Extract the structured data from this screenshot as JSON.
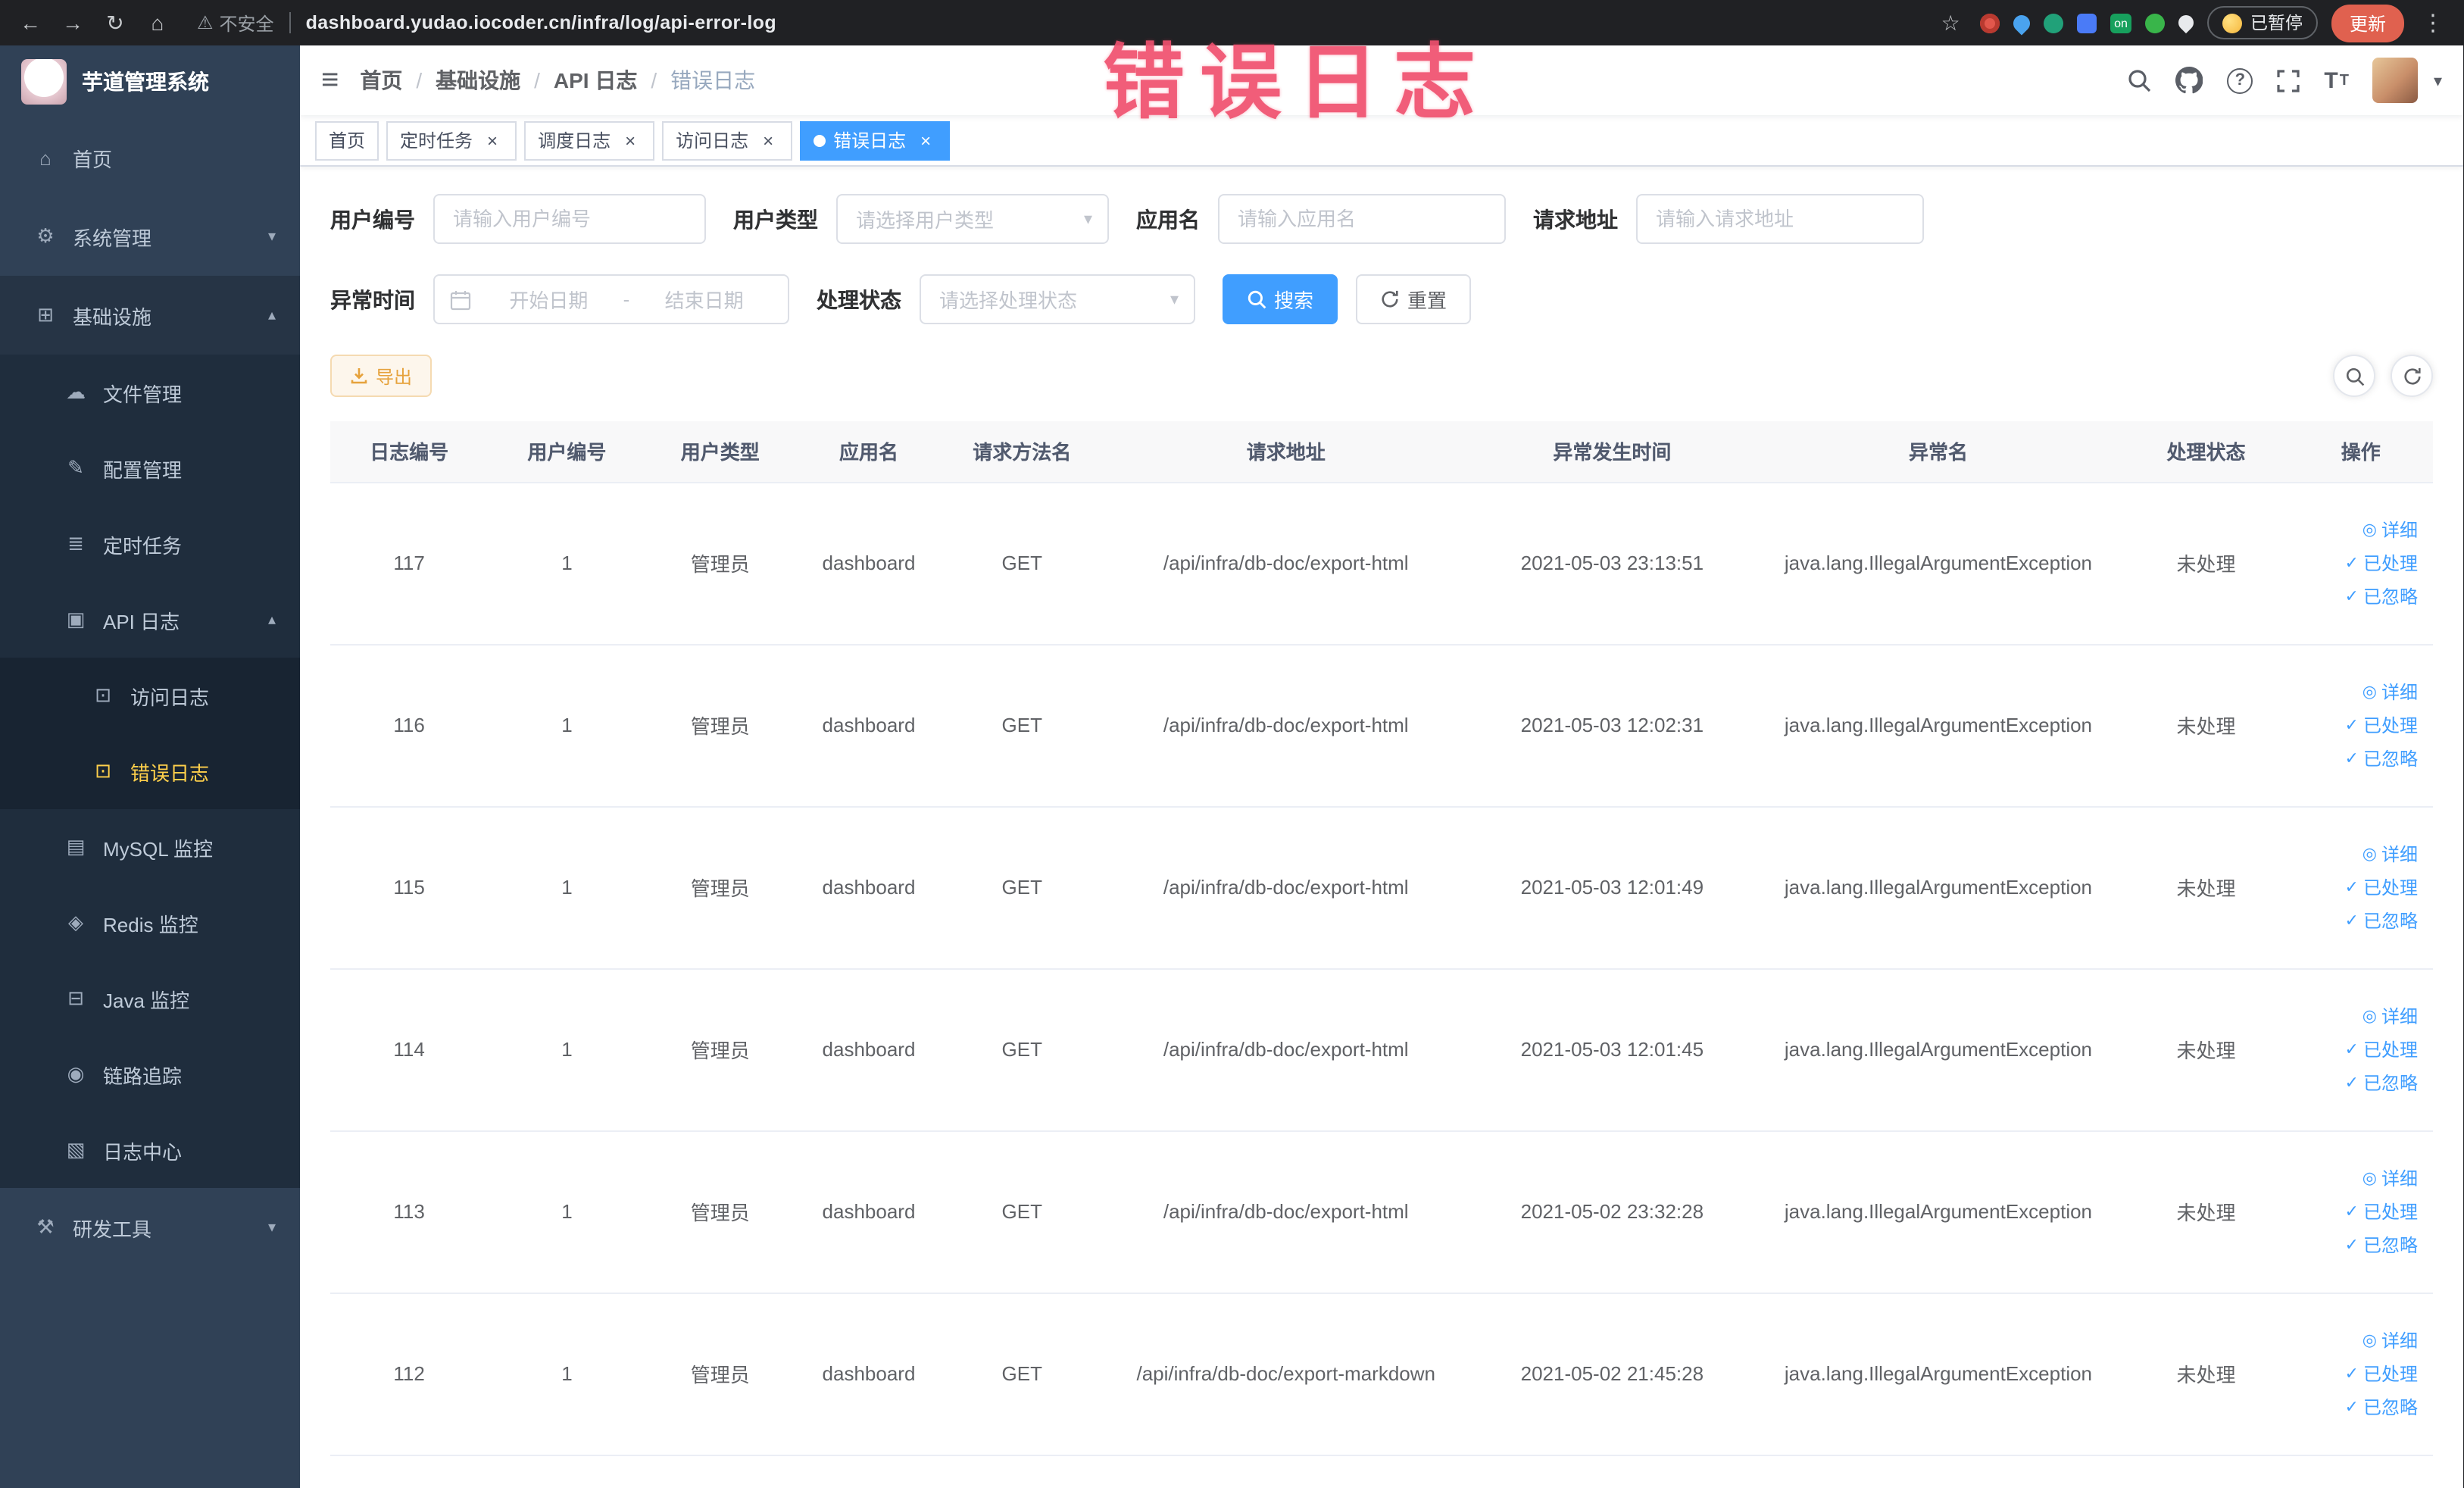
{
  "browser": {
    "security_label": "不安全",
    "url": "dashboard.yudao.iocoder.cn/infra/log/api-error-log",
    "extension_on_badge": "on",
    "paused_badge": "已暂停",
    "update_button": "更新"
  },
  "overlay": {
    "text": "错误日志",
    "color": "#f0506e"
  },
  "icons": {
    "back-icon": "←",
    "forward-icon": "→",
    "reload-icon": "↻",
    "browser-home-icon": "⌂",
    "warning-icon": "⚠",
    "star-icon": "☆",
    "kebab-icon": "⋮",
    "hamburger-icon": "≡",
    "help-icon": "?",
    "fontsize-icon": "T",
    "chevron-down-icon": "▾",
    "chevron-up-icon": "▴",
    "close-icon": "×",
    "home-icon": "⌂",
    "gear-icon": "⚙",
    "infrastructure-icon": "⊞",
    "file-manage-icon": "☁",
    "config-manage-icon": "✎",
    "cron-job-icon": "≣",
    "api-log-icon": "▣",
    "access-log-icon": "⊡",
    "error-log-icon": "⊡",
    "mysql-icon": "▤",
    "redis-icon": "◈",
    "java-icon": "⊟",
    "trace-icon": "◉",
    "log-center-icon": "▧",
    "dev-tools-icon": "⚒",
    "eye-icon": "◎",
    "check-icon": "✓"
  },
  "sidebar": {
    "logo_title": "芋道管理系统",
    "items": [
      {
        "key": "home",
        "label": "首页",
        "icon": "home-icon",
        "level": 1
      },
      {
        "key": "system-management",
        "label": "系统管理",
        "icon": "gear-icon",
        "level": 1,
        "arrow": "down"
      },
      {
        "key": "infrastructure",
        "label": "基础设施",
        "icon": "infrastructure-icon",
        "level": 1,
        "arrow": "up",
        "highlight": true
      },
      {
        "key": "file-management",
        "label": "文件管理",
        "icon": "file-manage-icon",
        "level": 2
      },
      {
        "key": "config-management",
        "label": "配置管理",
        "icon": "config-manage-icon",
        "level": 2
      },
      {
        "key": "cron-jobs",
        "label": "定时任务",
        "icon": "cron-job-icon",
        "level": 2
      },
      {
        "key": "api-logs",
        "label": "API 日志",
        "icon": "api-log-icon",
        "level": 2,
        "arrow": "up"
      },
      {
        "key": "access-log",
        "label": "访问日志",
        "icon": "access-log-icon",
        "level": 3
      },
      {
        "key": "error-log",
        "label": "错误日志",
        "icon": "error-log-icon",
        "level": 3,
        "active": true
      },
      {
        "key": "mysql-monitor",
        "label": "MySQL 监控",
        "icon": "mysql-icon",
        "level": 2
      },
      {
        "key": "redis-monitor",
        "label": "Redis 监控",
        "icon": "redis-icon",
        "level": 2
      },
      {
        "key": "java-monitor",
        "label": "Java 监控",
        "icon": "java-icon",
        "level": 2
      },
      {
        "key": "trace",
        "label": "链路追踪",
        "icon": "trace-icon",
        "level": 2
      },
      {
        "key": "log-center",
        "label": "日志中心",
        "icon": "log-center-icon",
        "level": 2
      },
      {
        "key": "dev-tools",
        "label": "研发工具",
        "icon": "dev-tools-icon",
        "level": 1,
        "arrow": "down"
      }
    ]
  },
  "breadcrumb": {
    "items": [
      "首页",
      "基础设施",
      "API 日志",
      "错误日志"
    ],
    "separator": "/"
  },
  "tabs": [
    {
      "key": "home",
      "label": "首页",
      "closable": false,
      "active": false
    },
    {
      "key": "cron-jobs",
      "label": "定时任务",
      "closable": true,
      "active": false
    },
    {
      "key": "job-log",
      "label": "调度日志",
      "closable": true,
      "active": false
    },
    {
      "key": "access-log",
      "label": "访问日志",
      "closable": true,
      "active": false
    },
    {
      "key": "error-log",
      "label": "错误日志",
      "closable": true,
      "active": true
    }
  ],
  "filters": {
    "user_id": {
      "label": "用户编号",
      "placeholder": "请输入用户编号"
    },
    "user_type": {
      "label": "用户类型",
      "placeholder": "请选择用户类型"
    },
    "app_name": {
      "label": "应用名",
      "placeholder": "请输入应用名"
    },
    "request_url": {
      "label": "请求地址",
      "placeholder": "请输入请求地址"
    },
    "exception_time": {
      "label": "异常时间",
      "start_placeholder": "开始日期",
      "separator": "-",
      "end_placeholder": "结束日期"
    },
    "process_status": {
      "label": "处理状态",
      "placeholder": "请选择处理状态"
    },
    "search_button": "搜索",
    "reset_button": "重置"
  },
  "toolbar": {
    "export_button": "导出"
  },
  "table": {
    "headers": [
      "日志编号",
      "用户编号",
      "用户类型",
      "应用名",
      "请求方法名",
      "请求地址",
      "异常发生时间",
      "异常名",
      "处理状态",
      "操作"
    ],
    "header_names": [
      "col-log-id",
      "col-user-id",
      "col-user-type",
      "col-app-name",
      "col-method",
      "col-request-url",
      "col-exception-time",
      "col-exception-name",
      "col-status",
      "col-actions"
    ],
    "fields": [
      "id",
      "user_id",
      "user_type",
      "app",
      "method",
      "url",
      "time",
      "exception",
      "status"
    ],
    "cell_names": [
      "log-id-cell",
      "user-id-cell",
      "user-type-cell",
      "app-name-cell",
      "method-cell",
      "request-url-cell",
      "exception-time-cell",
      "exception-name-cell",
      "status-cell"
    ],
    "actions": [
      {
        "key": "detail",
        "label": "详细",
        "icon": "eye-icon"
      },
      {
        "key": "processed",
        "label": "已处理",
        "icon": "check-icon"
      },
      {
        "key": "ignored",
        "label": "已忽略",
        "icon": "check-icon"
      }
    ],
    "rows": [
      {
        "id": "117",
        "user_id": "1",
        "user_type": "管理员",
        "app": "dashboard",
        "method": "GET",
        "url": "/api/infra/db-doc/export-html",
        "time": "2021-05-03 23:13:51",
        "exception": "java.lang.IllegalArgumentException",
        "status": "未处理"
      },
      {
        "id": "116",
        "user_id": "1",
        "user_type": "管理员",
        "app": "dashboard",
        "method": "GET",
        "url": "/api/infra/db-doc/export-html",
        "time": "2021-05-03 12:02:31",
        "exception": "java.lang.IllegalArgumentException",
        "status": "未处理"
      },
      {
        "id": "115",
        "user_id": "1",
        "user_type": "管理员",
        "app": "dashboard",
        "method": "GET",
        "url": "/api/infra/db-doc/export-html",
        "time": "2021-05-03 12:01:49",
        "exception": "java.lang.IllegalArgumentException",
        "status": "未处理"
      },
      {
        "id": "114",
        "user_id": "1",
        "user_type": "管理员",
        "app": "dashboard",
        "method": "GET",
        "url": "/api/infra/db-doc/export-html",
        "time": "2021-05-03 12:01:45",
        "exception": "java.lang.IllegalArgumentException",
        "status": "未处理"
      },
      {
        "id": "113",
        "user_id": "1",
        "user_type": "管理员",
        "app": "dashboard",
        "method": "GET",
        "url": "/api/infra/db-doc/export-html",
        "time": "2021-05-02 23:32:28",
        "exception": "java.lang.IllegalArgumentException",
        "status": "未处理"
      },
      {
        "id": "112",
        "user_id": "1",
        "user_type": "管理员",
        "app": "dashboard",
        "method": "GET",
        "url": "/api/infra/db-doc/export-markdown",
        "time": "2021-05-02 21:45:28",
        "exception": "java.lang.IllegalArgumentException",
        "status": "未处理"
      }
    ]
  },
  "colors": {
    "accent": "#409eff",
    "active_menu": "#ffd04b",
    "warning": "#e6a23c"
  }
}
